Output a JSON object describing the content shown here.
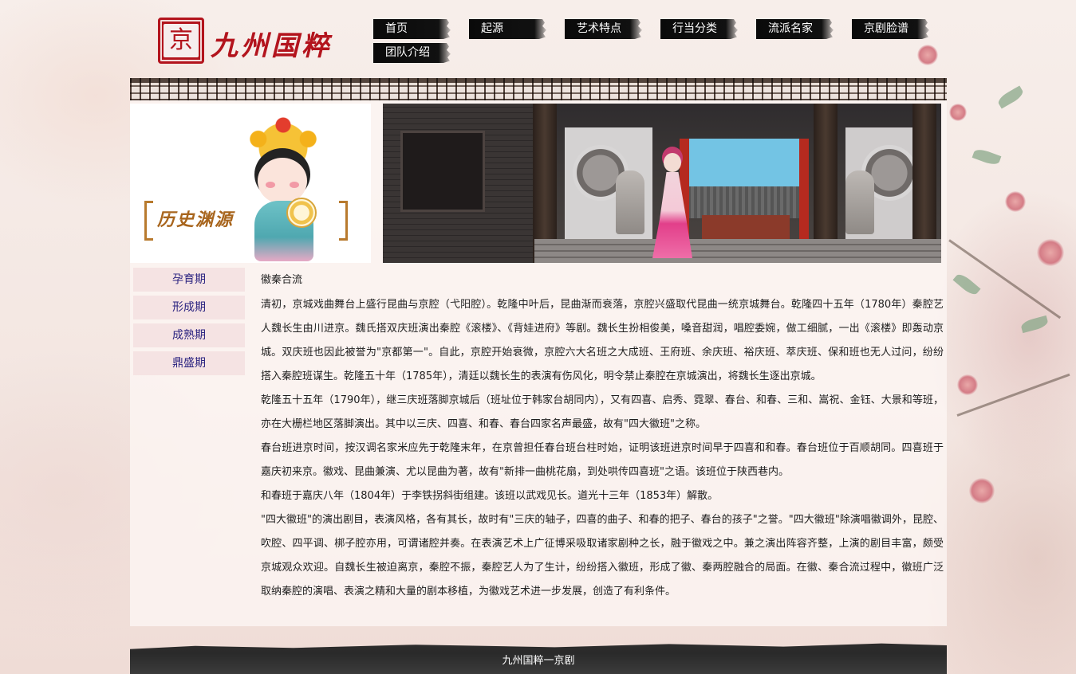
{
  "header": {
    "logo_seal": "京",
    "logo_text": "九州国粹"
  },
  "nav": {
    "items": [
      {
        "label": "首页"
      },
      {
        "label": "起源"
      },
      {
        "label": "艺术特点"
      },
      {
        "label": "行当分类"
      },
      {
        "label": "流派名家"
      },
      {
        "label": "京剧脸谱"
      },
      {
        "label": "团队介绍"
      }
    ]
  },
  "banner": {
    "title": "历史渊源"
  },
  "sidebar": {
    "items": [
      {
        "label": "孕育期"
      },
      {
        "label": "形成期"
      },
      {
        "label": "成熟期"
      },
      {
        "label": "鼎盛期"
      }
    ]
  },
  "content": {
    "title": "徽秦合流",
    "paragraphs": [
      "清初，京城戏曲舞台上盛行昆曲与京腔（弋阳腔）。乾隆中叶后，昆曲渐而衰落，京腔兴盛取代昆曲一统京城舞台。乾隆四十五年（1780年）秦腔艺人魏长生由川进京。魏氏搭双庆班演出秦腔《滚楼》、《背娃进府》等剧。魏长生扮相俊美，嗓音甜润，唱腔委婉，做工细腻，一出《滚楼》即轰动京城。双庆班也因此被誉为\"京都第一\"。自此，京腔开始衰微，京腔六大名班之大成班、王府班、余庆班、裕庆班、萃庆班、保和班也无人过问，纷纷搭入秦腔班谋生。乾隆五十年（1785年），清廷以魏长生的表演有伤风化，明令禁止秦腔在京城演出，将魏长生逐出京城。",
      "乾隆五十五年（1790年），继三庆班落脚京城后（班址位于韩家台胡同内），又有四喜、启秀、霓翠、春台、和春、三和、嵩祝、金钰、大景和等班，亦在大栅栏地区落脚演出。其中以三庆、四喜、和春、春台四家名声最盛，故有\"四大徽班\"之称。",
      "春台班进京时间，按汉调名家米应先于乾隆末年，在京曾担任春台班台柱时始，证明该班进京时间早于四喜和和春。春台班位于百顺胡同。四喜班于嘉庆初来京。徽戏、昆曲兼演、尤以昆曲为著，故有\"新排一曲桃花扇，到处哄传四喜班\"之语。该班位于陕西巷内。",
      "和春班于嘉庆八年（1804年）于李铁拐斜街组建。该班以武戏见长。道光十三年（1853年）解散。",
      "\"四大徽班\"的演出剧目，表演风格，各有其长，故时有\"三庆的轴子，四喜的曲子、和春的把子、春台的孩子\"之誉。\"四大徽班\"除演唱徽调外，昆腔、吹腔、四平调、梆子腔亦用，可谓诸腔并奏。在表演艺术上广征博采吸取诸家剧种之长，融于徽戏之中。兼之演出阵容齐整，上演的剧目丰富，颇受京城观众欢迎。自魏长生被迫离京，秦腔不振，秦腔艺人为了生计，纷纷搭入徽班，形成了徽、秦两腔融合的局面。在徽、秦合流过程中，徽班广泛取纳秦腔的演唱、表演之精和大量的剧本移植，为徽戏艺术进一步发展，创造了有利条件。"
    ]
  },
  "footer": {
    "text": "九州国粹一京剧"
  }
}
